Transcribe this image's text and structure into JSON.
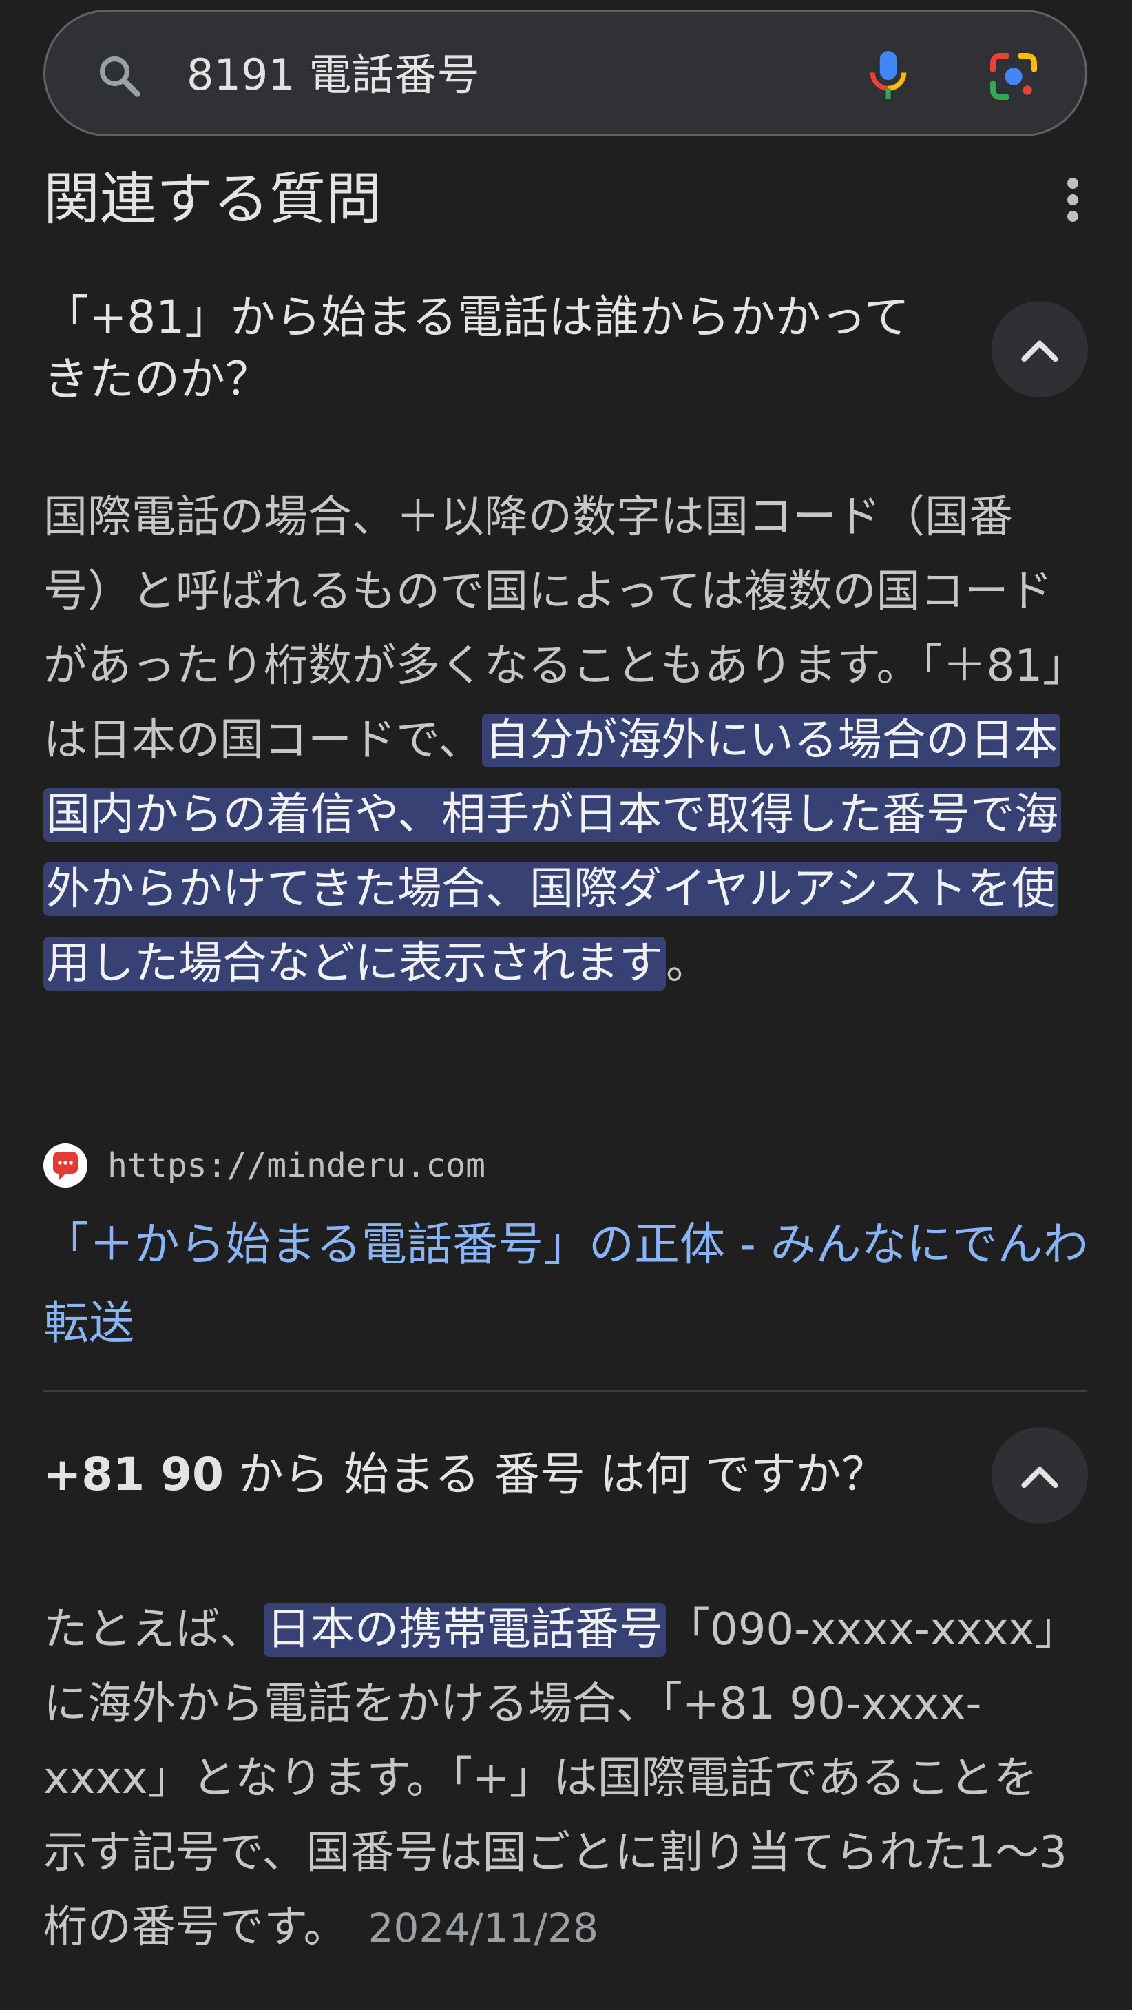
{
  "search": {
    "query": "8191 電話番号",
    "icons": {
      "search": "search-icon",
      "voice": "mic-icon",
      "lens": "google-lens-icon"
    }
  },
  "section": {
    "title": "関連する質問",
    "menu_icon": "more-vert-icon"
  },
  "questions": [
    {
      "question": "「+81」から始まる電話は誰からかかってきたのか？",
      "expanded": true,
      "answer_plain": "国際電話の場合、＋以降の数字は国コード（国番号）と呼ばれるもので国によっては複数の国コードがあったり桁数が多くなることもあります。「＋81」は日本の国コードで、",
      "answer_highlight": "自分が海外にいる場合の日本国内からの着信や、相手が日本で取得した番号で海外からかけてきた場合、国際ダイヤルアシストを使用した場合などに表示されます",
      "answer_tail": "。",
      "source": {
        "url": "https://minderu.com",
        "title": "「＋から始まる電話番号」の正体 - みんなにでんわ転送"
      }
    },
    {
      "question_num": "+81 90",
      "question_rest": " から 始まる 番号 は何 ですか？",
      "expanded": true,
      "answer_pre": "たとえば、",
      "answer_highlight": "日本の携帯電話番号",
      "answer_post": "「090-xxxx-xxxx」に海外から電話をかける場合、「+81 90-xxxx-xxxx」となります。「+」は国際電話であることを示す記号で、国番号は国ごとに割り当てられた1〜3桁の番号です。",
      "date": "2024/11/28"
    }
  ],
  "colors": {
    "background": "#1f1f1f",
    "search_bg": "#303134",
    "highlight": "#384173",
    "link": "#8ab4f8"
  }
}
